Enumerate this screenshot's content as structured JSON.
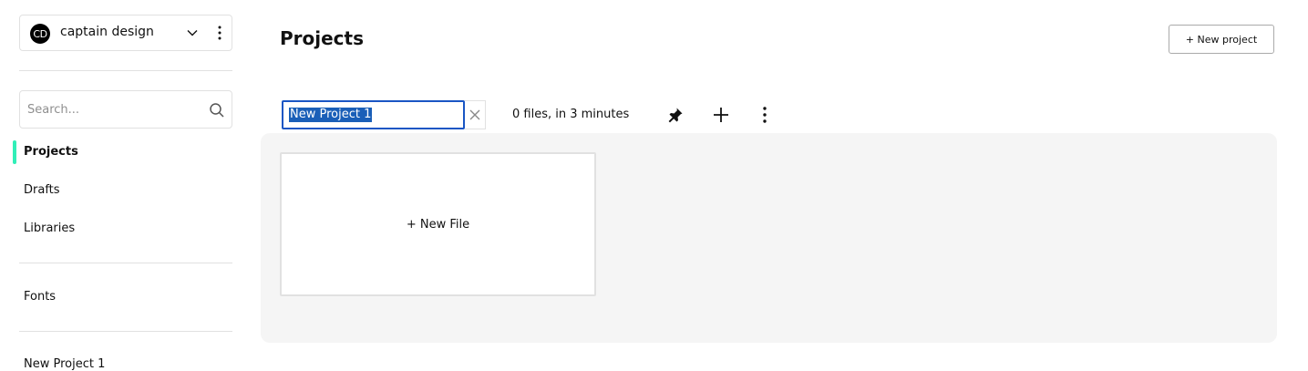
{
  "team": {
    "avatar_initials": "CD",
    "name": "captain design"
  },
  "search": {
    "placeholder": "Search..."
  },
  "sidebar": {
    "items": [
      {
        "label": "Projects",
        "active": true
      },
      {
        "label": "Drafts"
      },
      {
        "label": "Libraries"
      },
      {
        "label": "Fonts"
      }
    ],
    "pinned_projects": [
      {
        "label": "New Project 1"
      }
    ]
  },
  "header": {
    "title": "Projects",
    "new_project_label": "+ New project"
  },
  "project": {
    "rename_value": "New Project 1",
    "meta": "0 files, in 3 minutes",
    "new_file_label": "+ New File"
  },
  "colors": {
    "accent": "#31efb8",
    "selection": "#1a5fb8",
    "focus_border": "#1a56c4"
  },
  "icons": [
    "chevron-down-icon",
    "more-vertical-icon",
    "search-icon",
    "close-icon",
    "pin-icon",
    "plus-icon"
  ]
}
